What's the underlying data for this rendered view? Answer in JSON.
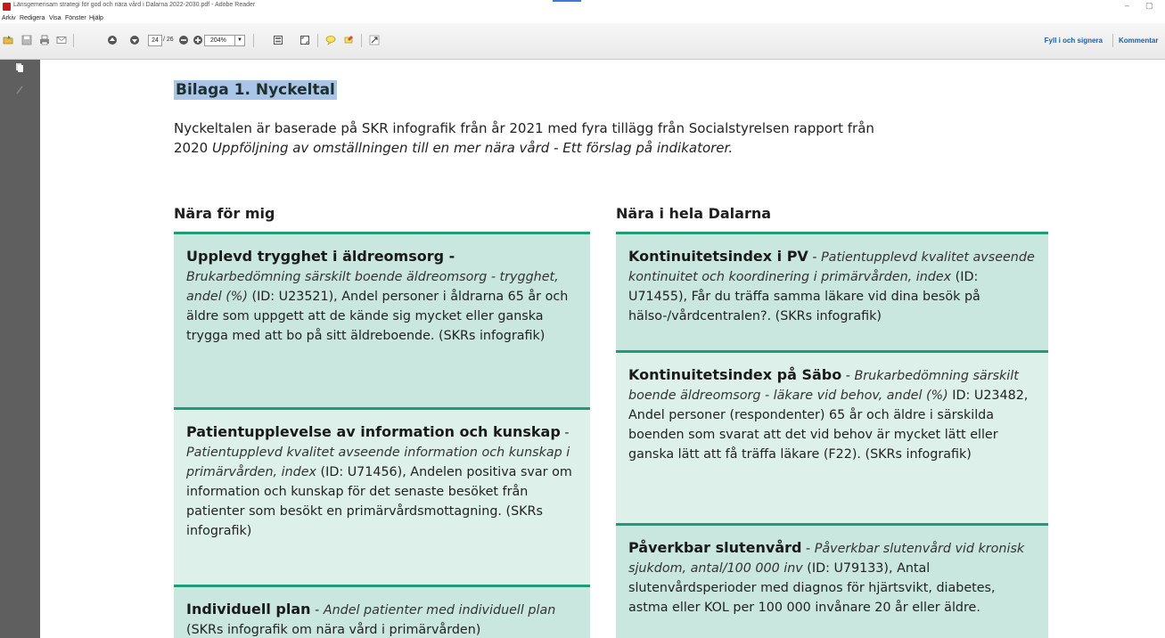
{
  "window": {
    "title": "Länsgemensam strategi för god och nära vård i Dalarna 2022-2030.pdf - Adobe Reader",
    "min": "–",
    "restore": "▢"
  },
  "menu": [
    "Arkiv",
    "Redigera",
    "Visa",
    "Fönster",
    "Hjälp"
  ],
  "toolbar": {
    "page_current": "24",
    "page_total": "/ 26",
    "zoom": "204%",
    "fill_sign": "Fyll i och signera",
    "comment": "Kommentar"
  },
  "doc": {
    "heading": "Bilaga 1. Nyckeltal",
    "intro_plain": "Nyckeltalen är baserade på SKR infografik från år 2021 med fyra tillägg från Socialstyrelsen rapport från 2020 ",
    "intro_italic": "Uppföljning av omställningen till en mer nära vård - Ett förslag på indikatorer.",
    "left_heading": "Nära för mig",
    "right_heading": "Nära i hela Dalarna",
    "left_cards": [
      {
        "bold": "Upplevd trygghet i äldreomsorg -",
        "italic": "Brukarbedömning särskilt boende äldreomsorg - trygghet, andel (%)",
        "plain": " (ID: U23521), Andel personer i åldrarna 65 år och äldre som uppgett att de kände sig mycket eller ganska trygga med att bo på sitt äldreboende. (SKRs infografik)"
      },
      {
        "bold": "Patientupplevelse av information och kunskap",
        "italic": "Patientupplevd kvalitet avseende information och kunskap i primärvården, index",
        "plain": " (ID: U71456), Andelen positiva svar om information och kunskap för det senaste besöket från patienter som besökt en primärvårdsmottagning. (SKRs infografik)"
      },
      {
        "bold": "Individuell plan",
        "italic": "Andel patienter med individuell plan",
        "plain": " (SKRs infografik om nära vård i primärvården)"
      }
    ],
    "right_cards": [
      {
        "bold": "Kontinuitetsindex i PV",
        "italic": "Patientupplevd kvalitet avseende kontinuitet och koordinering i primärvården, index",
        "plain": " (ID: U71455), Får du träffa samma läkare vid dina besök på hälso-/vårdcentralen?. (SKRs infografik)"
      },
      {
        "bold": "Kontinuitetsindex på Säbo",
        "italic": "Brukarbedömning särskilt boende äldreomsorg - läkare vid behov, andel (%)",
        "plain": " ID: U23482, Andel personer (respondenter) 65 år och äldre i särskilda boenden som svarat att det vid behov är mycket lätt eller ganska lätt att få träffa läkare (F22). (SKRs infografik)"
      },
      {
        "bold": "Påverkbar slutenvård",
        "italic": "Påverkbar slutenvård vid kronisk sjukdom, antal/100 000 inv",
        "plain": " (ID: U79133), Antal slutenvårdsperioder med diagnos för hjärtsvikt, diabetes, astma eller KOL per 100 000 invånare 20 år eller äldre."
      }
    ]
  }
}
